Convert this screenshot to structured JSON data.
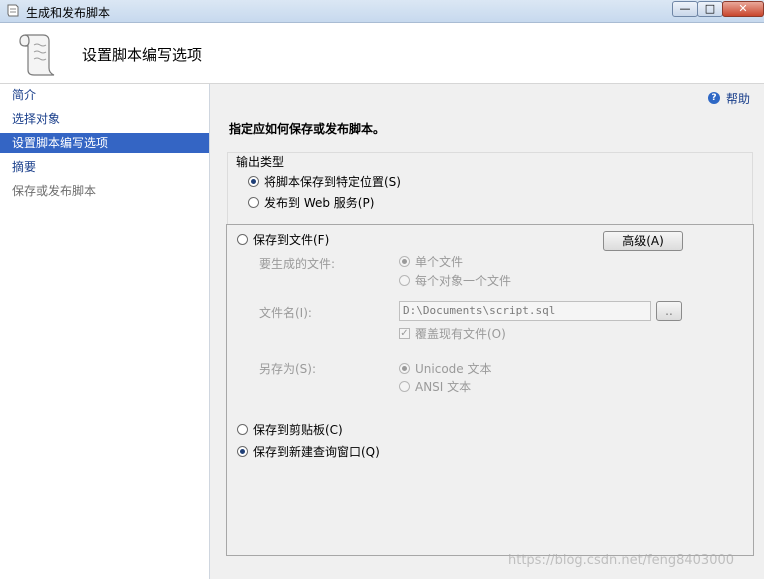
{
  "window": {
    "title": "生成和发布脚本",
    "min_glyph": "—",
    "max_glyph": "□",
    "close_glyph": "✕"
  },
  "header": {
    "title": "设置脚本编写选项",
    "icon": "scroll-icon"
  },
  "nav": {
    "items": [
      {
        "label": "简介",
        "state": "normal"
      },
      {
        "label": "选择对象",
        "state": "normal"
      },
      {
        "label": "设置脚本编写选项",
        "state": "selected"
      },
      {
        "label": "摘要",
        "state": "normal"
      },
      {
        "label": "保存或发布脚本",
        "state": "disabled"
      }
    ]
  },
  "help": {
    "label": "帮助",
    "icon": "help-icon"
  },
  "instruction": "指定应如何保存或发布脚本。",
  "output_type": {
    "label": "输出类型",
    "options": [
      {
        "label": "将脚本保存到特定位置(S)",
        "checked": true
      },
      {
        "label": "发布到 Web 服务(P)",
        "checked": false
      }
    ]
  },
  "save": {
    "to_file": {
      "label": "保存到文件(F)",
      "checked": false
    },
    "advanced_button": "高级(A)",
    "files_label": "要生成的文件:",
    "file_options": [
      {
        "label": "单个文件",
        "checked": true
      },
      {
        "label": "每个对象一个文件",
        "checked": false
      }
    ],
    "filename_label": "文件名(I):",
    "filename_value": "D:\\Documents\\script.sql",
    "browse_button": "..",
    "overwrite_label": "覆盖现有文件(O)",
    "overwrite_checked": true,
    "save_as_label": "另存为(S):",
    "encoding_options": [
      {
        "label": "Unicode 文本",
        "checked": true
      },
      {
        "label": "ANSI 文本",
        "checked": false
      }
    ],
    "to_clipboard": {
      "label": "保存到剪贴板(C)",
      "checked": false
    },
    "to_query_window": {
      "label": "保存到新建查询窗口(Q)",
      "checked": true
    }
  },
  "watermark": "https://blog.csdn.net/feng8403000"
}
